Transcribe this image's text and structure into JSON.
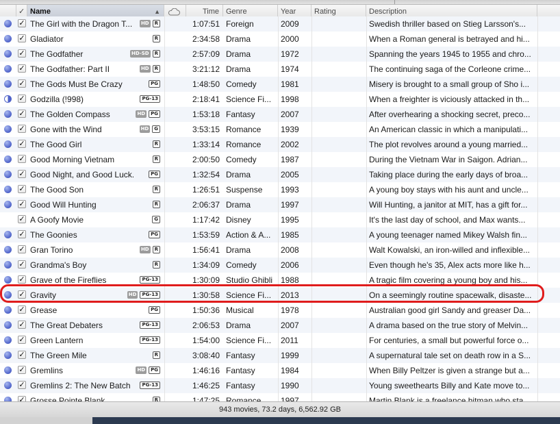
{
  "columns": {
    "check": "✓",
    "name": "Name",
    "name_sort": "▲",
    "time": "Time",
    "genre": "Genre",
    "year": "Year",
    "rating": "Rating",
    "description": "Description"
  },
  "movies": [
    {
      "status": "full",
      "checked": true,
      "name": "The Girl with the Dragon T...",
      "hd": "HD",
      "rating": "R",
      "time": "1:07:51",
      "genre": "Foreign",
      "year": "2009",
      "desc": "Swedish thriller based on Stieg Larsson's..."
    },
    {
      "status": "full",
      "checked": true,
      "name": "Gladiator",
      "hd": "",
      "rating": "R",
      "time": "2:34:58",
      "genre": "Drama",
      "year": "2000",
      "desc": "When a Roman general is betrayed and hi..."
    },
    {
      "status": "full",
      "checked": true,
      "name": "The Godfather",
      "hd": "HD-SD",
      "rating": "R",
      "time": "2:57:09",
      "genre": "Drama",
      "year": "1972",
      "desc": "Spanning the years 1945 to 1955 and chro..."
    },
    {
      "status": "full",
      "checked": true,
      "name": "The Godfather: Part II",
      "hd": "HD",
      "rating": "R",
      "time": "3:21:12",
      "genre": "Drama",
      "year": "1974",
      "desc": "The continuing saga of the Corleone crime..."
    },
    {
      "status": "full",
      "checked": true,
      "name": "The Gods Must Be Crazy",
      "hd": "",
      "rating": "PG",
      "time": "1:48:50",
      "genre": "Comedy",
      "year": "1981",
      "desc": "Misery is brought to a small group of Sho i..."
    },
    {
      "status": "half",
      "checked": true,
      "name": "Godzilla (!998)",
      "hd": "",
      "rating": "PG-13",
      "time": "2:18:41",
      "genre": "Science Fi...",
      "year": "1998",
      "desc": "When a freighter is viciously attacked in th..."
    },
    {
      "status": "full",
      "checked": true,
      "name": "The Golden Compass",
      "hd": "HD",
      "rating": "PG",
      "time": "1:53:18",
      "genre": "Fantasy",
      "year": "2007",
      "desc": "After overhearing a shocking secret, preco..."
    },
    {
      "status": "full",
      "checked": true,
      "name": "Gone with the Wind",
      "hd": "HD",
      "rating": "G",
      "time": "3:53:15",
      "genre": "Romance",
      "year": "1939",
      "desc": "An American classic in which a manipulati..."
    },
    {
      "status": "full",
      "checked": true,
      "name": "The Good Girl",
      "hd": "",
      "rating": "R",
      "time": "1:33:14",
      "genre": "Romance",
      "year": "2002",
      "desc": "The plot revolves around a young married..."
    },
    {
      "status": "full",
      "checked": true,
      "name": "Good Morning Vietnam",
      "hd": "",
      "rating": "R",
      "time": "2:00:50",
      "genre": "Comedy",
      "year": "1987",
      "desc": "During the Vietnam War in Saigon.  Adrian..."
    },
    {
      "status": "full",
      "checked": true,
      "name": "Good Night, and Good Luck.",
      "hd": "",
      "rating": "PG",
      "time": "1:32:54",
      "genre": "Drama",
      "year": "2005",
      "desc": "Taking place during the early days of broa..."
    },
    {
      "status": "full",
      "checked": true,
      "name": "The Good Son",
      "hd": "",
      "rating": "R",
      "time": "1:26:51",
      "genre": "Suspense",
      "year": "1993",
      "desc": "A young boy stays with his aunt and uncle..."
    },
    {
      "status": "full",
      "checked": true,
      "name": "Good Will Hunting",
      "hd": "",
      "rating": "R",
      "time": "2:06:37",
      "genre": "Drama",
      "year": "1997",
      "desc": "Will Hunting, a janitor at MIT, has a gift for..."
    },
    {
      "status": "none",
      "checked": true,
      "name": "A Goofy Movie",
      "hd": "",
      "rating": "G",
      "time": "1:17:42",
      "genre": "Disney",
      "year": "1995",
      "desc": "It's the last day of school, and Max wants..."
    },
    {
      "status": "full",
      "checked": true,
      "name": "The Goonies",
      "hd": "",
      "rating": "PG",
      "time": "1:53:59",
      "genre": "Action & A...",
      "year": "1985",
      "desc": "A young teenager named Mikey Walsh fin..."
    },
    {
      "status": "full",
      "checked": true,
      "name": "Gran Torino",
      "hd": "HD",
      "rating": "R",
      "time": "1:56:41",
      "genre": "Drama",
      "year": "2008",
      "desc": "Walt Kowalski, an iron-willed and inflexible..."
    },
    {
      "status": "full",
      "checked": true,
      "name": "Grandma's Boy",
      "hd": "",
      "rating": "R",
      "time": "1:34:09",
      "genre": "Comedy",
      "year": "2006",
      "desc": "Even though he's 35, Alex acts more like h..."
    },
    {
      "status": "full",
      "checked": true,
      "name": "Grave of the Fireflies",
      "hd": "",
      "rating": "PG-13",
      "time": "1:30:09",
      "genre": "Studio Ghibli",
      "year": "1988",
      "desc": "A tragic film covering a young boy and his..."
    },
    {
      "status": "full",
      "checked": true,
      "name": "Gravity",
      "hd": "HD",
      "rating": "PG-13",
      "time": "1:30:58",
      "genre": "Science Fi...",
      "year": "2013",
      "desc": "On a seemingly routine spacewalk, disaste..."
    },
    {
      "status": "full",
      "checked": true,
      "name": "Grease",
      "hd": "",
      "rating": "PG",
      "time": "1:50:36",
      "genre": "Musical",
      "year": "1978",
      "desc": "Australian good girl Sandy and greaser Da..."
    },
    {
      "status": "full",
      "checked": true,
      "name": "The Great Debaters",
      "hd": "",
      "rating": "PG-13",
      "time": "2:06:53",
      "genre": "Drama",
      "year": "2007",
      "desc": "A drama based on the true story of Melvin..."
    },
    {
      "status": "full",
      "checked": true,
      "name": "Green Lantern",
      "hd": "",
      "rating": "PG-13",
      "time": "1:54:00",
      "genre": "Science Fi...",
      "year": "2011",
      "desc": "For centuries, a small but powerful force o..."
    },
    {
      "status": "full",
      "checked": true,
      "name": "The Green Mile",
      "hd": "",
      "rating": "R",
      "time": "3:08:40",
      "genre": "Fantasy",
      "year": "1999",
      "desc": "A supernatural tale set on death row in a S..."
    },
    {
      "status": "full",
      "checked": true,
      "name": "Gremlins",
      "hd": "HD",
      "rating": "PG",
      "time": "1:46:16",
      "genre": "Fantasy",
      "year": "1984",
      "desc": "When Billy Peltzer is given a strange but a..."
    },
    {
      "status": "full",
      "checked": true,
      "name": "Gremlins 2: The New Batch",
      "hd": "",
      "rating": "PG-13",
      "time": "1:46:25",
      "genre": "Fantasy",
      "year": "1990",
      "desc": "Young sweethearts Billy and Kate move to..."
    },
    {
      "status": "full",
      "checked": true,
      "name": "Grosse Pointe Blank",
      "hd": "",
      "rating": "R",
      "time": "1:47:25",
      "genre": "Romance",
      "year": "1997",
      "desc": "Martin Blank is a freelance hitman who sta..."
    }
  ],
  "selected_movie": "Gravity",
  "status_bar": {
    "summary": "943 movies, 73.2 days, 6,562.92 GB"
  }
}
